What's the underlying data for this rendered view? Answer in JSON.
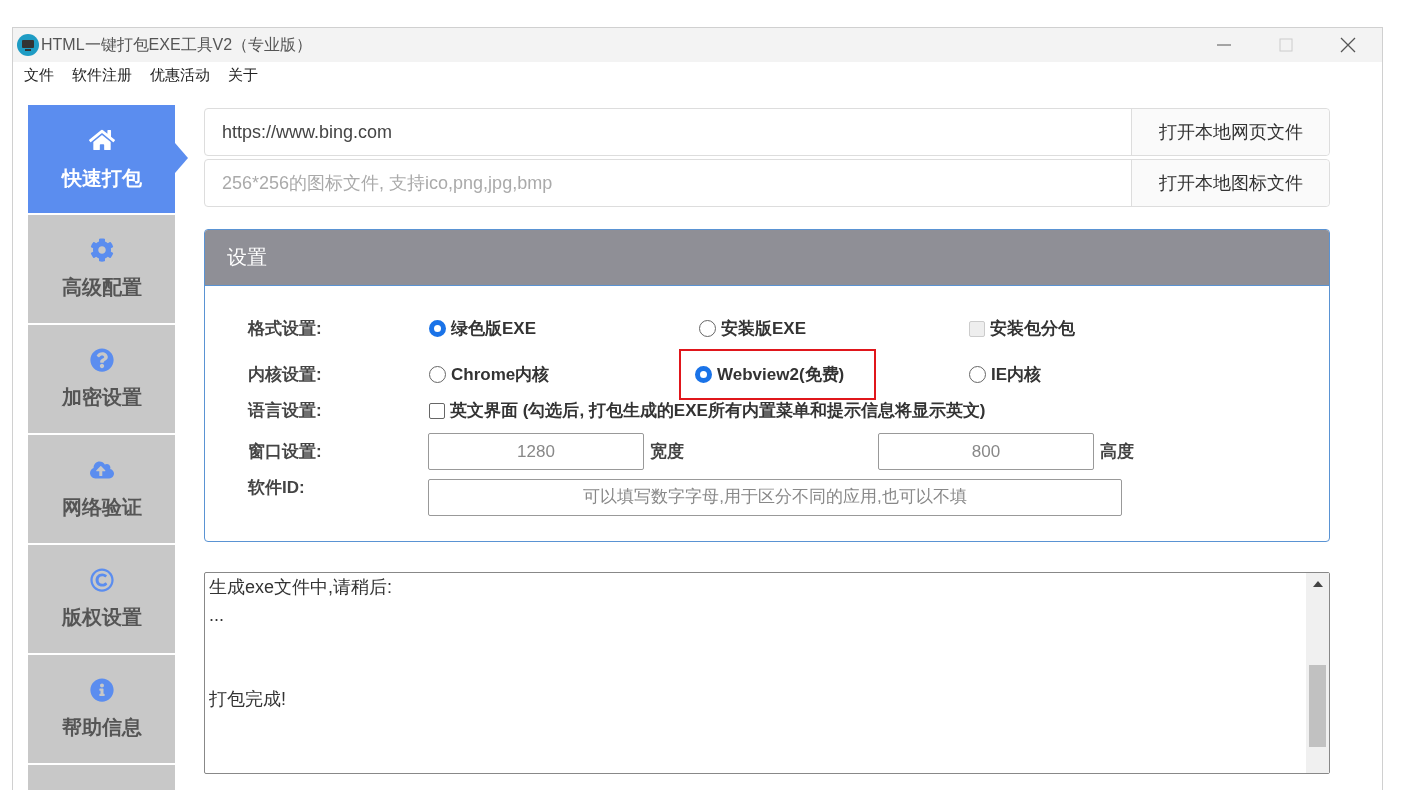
{
  "window": {
    "title": "HTML一键打包EXE工具V2（专业版）",
    "maximize_disabled": true
  },
  "menu": [
    "文件",
    "软件注册",
    "优惠活动",
    "关于"
  ],
  "sidebar": {
    "items": [
      {
        "label": "快速打包",
        "selected": true
      },
      {
        "label": "高级配置",
        "selected": false
      },
      {
        "label": "加密设置",
        "selected": false
      },
      {
        "label": "网络验证",
        "selected": false
      },
      {
        "label": "版权设置",
        "selected": false
      },
      {
        "label": "帮助信息",
        "selected": false
      }
    ]
  },
  "source": {
    "url_value": "https://www.bing.com",
    "open_page_button": "打开本地网页文件",
    "icon_placeholder": "256*256的图标文件, 支持ico,png,jpg,bmp",
    "open_icon_button": "打开本地图标文件"
  },
  "settings": {
    "title": "设置",
    "rows": [
      {
        "label": "格式设置:",
        "kind": "options",
        "options": [
          {
            "kind": "radio",
            "label": "绿色版EXE",
            "selected": true,
            "highlighted": false
          },
          {
            "kind": "radio",
            "label": "安装版EXE",
            "selected": false,
            "highlighted": false
          },
          {
            "kind": "checkbox",
            "label": "安装包分包",
            "checked": false,
            "highlighted": false,
            "disabled": true
          }
        ]
      },
      {
        "label": "内核设置:",
        "kind": "options",
        "options": [
          {
            "kind": "radio",
            "label": "Chrome内核",
            "selected": false,
            "highlighted": false
          },
          {
            "kind": "radio",
            "label": "Webview2(免费)",
            "selected": true,
            "highlighted": true
          },
          {
            "kind": "radio",
            "label": "IE内核",
            "selected": false,
            "highlighted": false
          }
        ]
      },
      {
        "label": "语言设置:",
        "kind": "checkbox",
        "option": {
          "label": "英文界面 (勾选后, 打包生成的EXE所有内置菜单和提示信息将显示英文)",
          "checked": false
        }
      },
      {
        "label": "窗口设置:",
        "kind": "size",
        "width_placeholder": "1280",
        "width_unit": "宽度",
        "height_placeholder": "800",
        "height_unit": "高度"
      },
      {
        "label": "软件ID:",
        "kind": "text",
        "placeholder": "可以填写数字字母,用于区分不同的应用,也可以不填"
      }
    ]
  },
  "log": {
    "blocks": [
      [
        "生成exe文件中,请稍后:",
        "..."
      ],
      [
        "打包完成!"
      ]
    ]
  }
}
